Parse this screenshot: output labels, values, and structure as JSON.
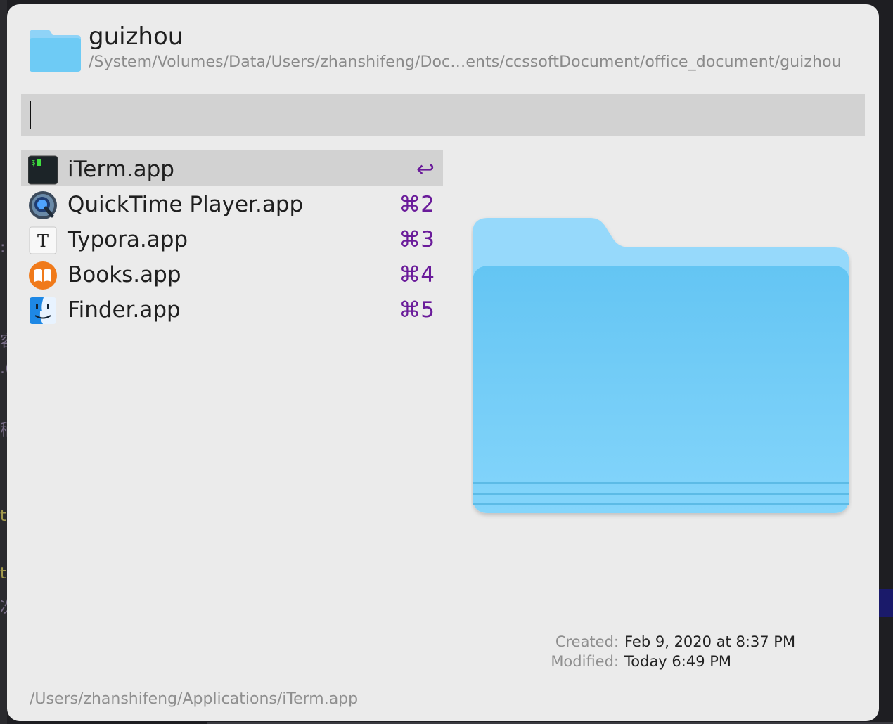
{
  "header": {
    "title": "guizhou",
    "path": "/System/Volumes/Data/Users/zhanshifeng/Doc…ents/ccssoftDocument/office_document/guizhou"
  },
  "search": {
    "value": ""
  },
  "results": [
    {
      "label": "iTerm.app",
      "shortcut": "↩",
      "icon": "iterm-icon",
      "selected": true
    },
    {
      "label": "QuickTime Player.app",
      "shortcut": "⌘2",
      "icon": "quicktime-icon"
    },
    {
      "label": "Typora.app",
      "shortcut": "⌘3",
      "icon": "typora-icon"
    },
    {
      "label": "Books.app",
      "shortcut": "⌘4",
      "icon": "books-icon"
    },
    {
      "label": "Finder.app",
      "shortcut": "⌘5",
      "icon": "finder-icon"
    }
  ],
  "meta": {
    "created_label": "Created:",
    "created_value": "Feb 9, 2020 at 8:37 PM",
    "modified_label": "Modified:",
    "modified_value": "Today 6:49 PM"
  },
  "footer": {
    "path": "/Users/zhanshifeng/Applications/iTerm.app"
  },
  "colors": {
    "panel_bg": "#ebebeb",
    "selection_bg": "#d2d2d2",
    "shortcut": "#6a1b9a",
    "folder_blue": "#6ecbf5"
  }
}
